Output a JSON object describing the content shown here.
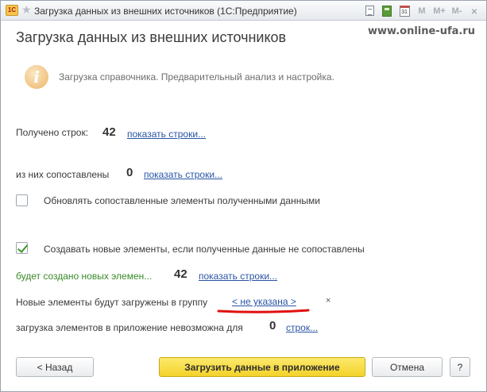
{
  "window": {
    "title": "Загрузка данных из внешних источников",
    "app_name": "(1С:Предприятие)",
    "app_icon_text": "1С",
    "toolbar": {
      "m": "M",
      "m_plus": "M+",
      "m_minus": "M-",
      "close": "×",
      "calendar_day": "31"
    }
  },
  "header": {
    "title": "Загрузка данных из внешних источников",
    "watermark": "www.online-ufa.ru"
  },
  "info": {
    "icon": "i",
    "text": "Загрузка справочника. Предварительный анализ и настройка."
  },
  "rows": {
    "received": {
      "label": "Получено строк:",
      "count": "42",
      "link": "показать строки..."
    },
    "matched": {
      "label": "из них сопоставлены",
      "count": "0",
      "link": "показать строки..."
    },
    "update_checkbox": {
      "label": "Обновлять сопоставленные элементы полученными данными",
      "checked": false
    },
    "create_checkbox": {
      "label": "Создавать новые элементы, если полученные данные не сопоставлены",
      "checked": true
    },
    "new_items": {
      "label": "будет создано новых элемен...",
      "count": "42",
      "link": "показать строки..."
    },
    "group": {
      "label": "Новые элементы будут загружены в группу",
      "value": "< не указана >",
      "clear": "×"
    },
    "impossible": {
      "label": "загрузка элементов в приложение невозможна для",
      "count": "0",
      "link": "строк..."
    }
  },
  "buttons": {
    "back": "< Назад",
    "load": "Загрузить данные в приложение",
    "cancel": "Отмена",
    "help": "?"
  },
  "colors": {
    "accent_link": "#2a54a5",
    "green_text": "#3a8a2a",
    "primary_button": "#f3d22a",
    "annotation_red": "#e01010"
  }
}
